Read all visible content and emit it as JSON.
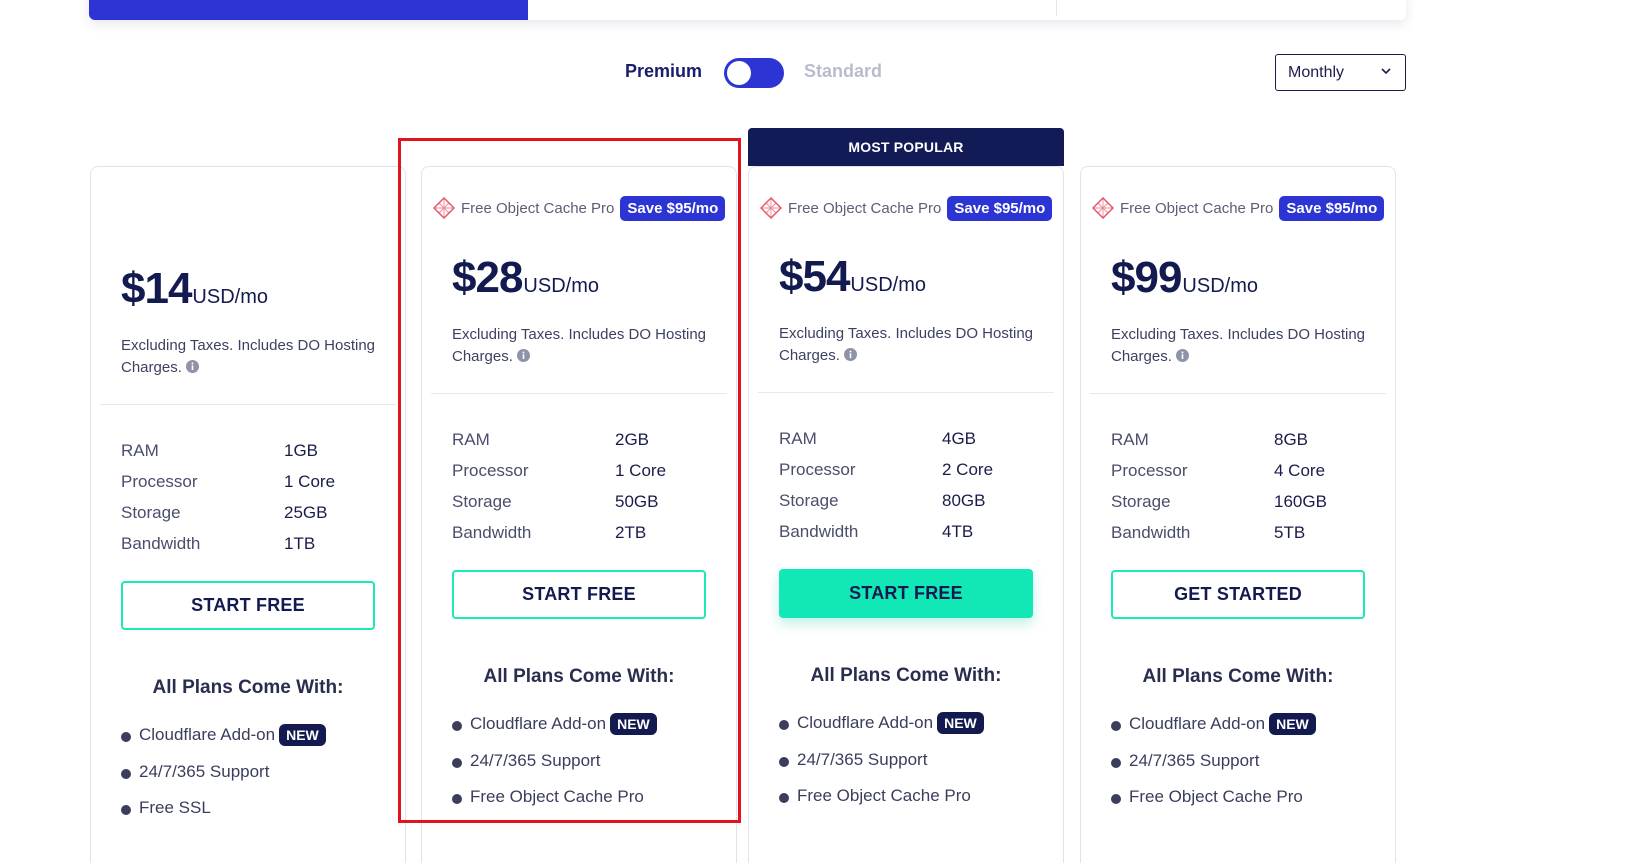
{
  "toggle": {
    "premium_label": "Premium",
    "standard_label": "Standard"
  },
  "period": {
    "selected": "Monthly"
  },
  "popular_badge": "MOST POPULAR",
  "plans": [
    {
      "promo_text": "",
      "promo_save": "",
      "price": "$14",
      "price_unit": "USD/mo",
      "tax_note": "Excluding Taxes. Includes DO Hosting Charges.",
      "specs": [
        {
          "label": "RAM",
          "value": "1GB"
        },
        {
          "label": "Processor",
          "value": "1 Core"
        },
        {
          "label": "Storage",
          "value": "25GB"
        },
        {
          "label": "Bandwidth",
          "value": "1TB"
        }
      ],
      "cta": "START FREE",
      "all_plans_title": "All Plans Come With:",
      "features": [
        "Cloudflare Add-on",
        "24/7/365 Support",
        "Free SSL"
      ]
    },
    {
      "promo_text": "Free Object Cache Pro",
      "promo_save": "Save $95/mo",
      "price": "$28",
      "price_unit": "USD/mo",
      "tax_note": "Excluding Taxes. Includes DO Hosting Charges.",
      "specs": [
        {
          "label": "RAM",
          "value": "2GB"
        },
        {
          "label": "Processor",
          "value": "1 Core"
        },
        {
          "label": "Storage",
          "value": "50GB"
        },
        {
          "label": "Bandwidth",
          "value": "2TB"
        }
      ],
      "cta": "START FREE",
      "all_plans_title": "All Plans Come With:",
      "features": [
        "Cloudflare Add-on",
        "24/7/365 Support",
        "Free Object Cache Pro"
      ]
    },
    {
      "promo_text": "Free Object Cache Pro",
      "promo_save": "Save $95/mo",
      "price": "$54",
      "price_unit": "USD/mo",
      "tax_note": "Excluding Taxes. Includes DO Hosting Charges.",
      "specs": [
        {
          "label": "RAM",
          "value": "4GB"
        },
        {
          "label": "Processor",
          "value": "2 Core"
        },
        {
          "label": "Storage",
          "value": "80GB"
        },
        {
          "label": "Bandwidth",
          "value": "4TB"
        }
      ],
      "cta": "START FREE",
      "all_plans_title": "All Plans Come With:",
      "features": [
        "Cloudflare Add-on",
        "24/7/365 Support",
        "Free Object Cache Pro"
      ]
    },
    {
      "promo_text": "Free Object Cache Pro",
      "promo_save": "Save $95/mo",
      "price": "$99",
      "price_unit": "USD/mo",
      "tax_note": "Excluding Taxes. Includes DO Hosting Charges.",
      "specs": [
        {
          "label": "RAM",
          "value": "8GB"
        },
        {
          "label": "Processor",
          "value": "4 Core"
        },
        {
          "label": "Storage",
          "value": "160GB"
        },
        {
          "label": "Bandwidth",
          "value": "5TB"
        }
      ],
      "cta": "GET STARTED",
      "all_plans_title": "All Plans Come With:",
      "features": [
        "Cloudflare Add-on",
        "24/7/365 Support",
        "Free Object Cache Pro"
      ]
    }
  ],
  "new_badge": "NEW",
  "colors": {
    "brand_blue": "#2c35d4",
    "navy": "#131a4f",
    "cta_green": "#12e8b5",
    "highlight_red": "#e0131e"
  },
  "icons": {
    "promo": "cache-diamond-icon",
    "info": "info-icon",
    "select": "chevron-down-icon"
  }
}
